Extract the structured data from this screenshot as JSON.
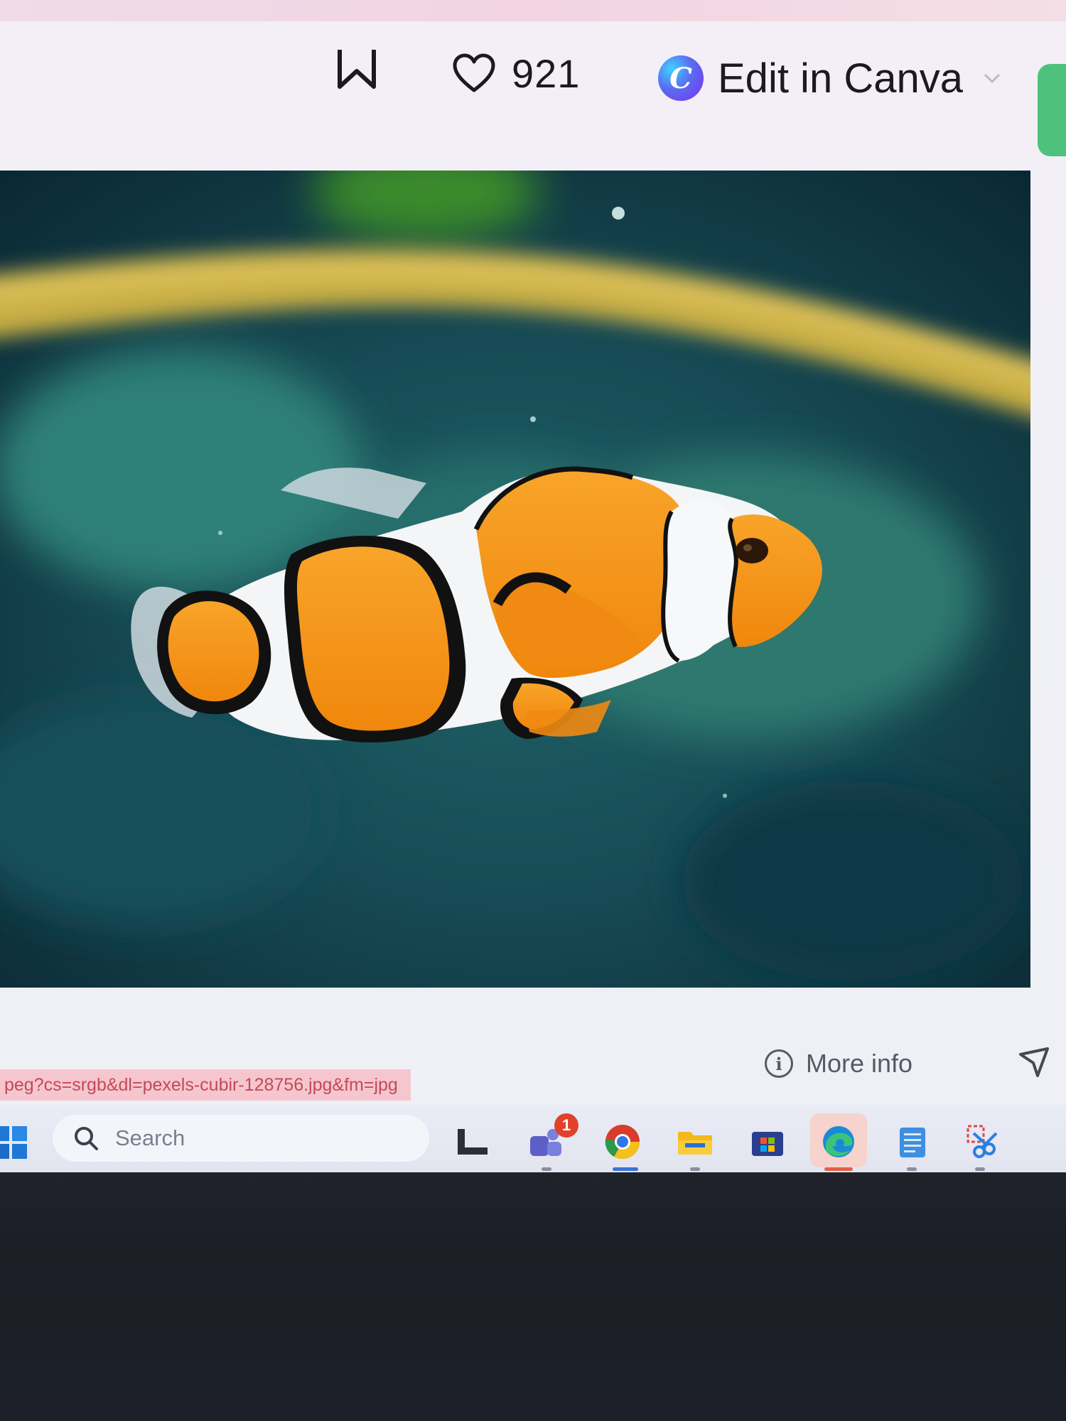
{
  "toolbar": {
    "like_count": "921",
    "canva_logo_letter": "C",
    "canva_label": "Edit in Canva",
    "icons": [
      "w-icon",
      "heart-icon",
      "canva-logo-icon",
      "chevron-down-icon"
    ]
  },
  "photo": {
    "subject": "clownfish"
  },
  "info_bar": {
    "more_info_label": "More info",
    "info_icon_glyph": "i",
    "icons": [
      "info-icon",
      "send-icon"
    ]
  },
  "status_bar": {
    "url_fragment": "peg?cs=srgb&dl=pexels-cubir-128756.jpg&fm=jpg"
  },
  "taskbar": {
    "search_label": "Search",
    "teams_badge": "1",
    "icons": [
      "windows-start-icon",
      "search-icon",
      "task-view-icon",
      "teams-icon",
      "chrome-icon",
      "file-explorer-icon",
      "microsoft-store-icon",
      "edge-icon",
      "notepad-icon",
      "snipping-tool-icon"
    ]
  },
  "colors": {
    "screen_bg": "#f1f0f7",
    "url_highlight_bg": "#f6c6cf",
    "url_text": "#c34a57",
    "fish_orange": "#f79a14",
    "water": "#12404a"
  }
}
